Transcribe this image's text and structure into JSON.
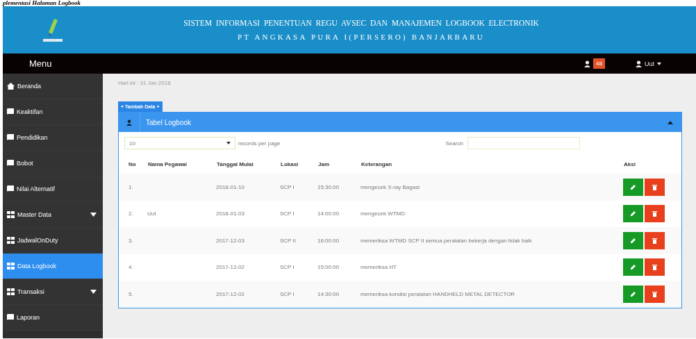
{
  "document_caption": "plementasi Halaman Logbook",
  "header": {
    "title": "SISTEM  INFORMASI  PENENTUAN  REGU  AVSEC  DAN  MANAJEMEN  LOGBOOK  ELECTRONIK",
    "subtitle": "PT ANGKASA PURA I(PERSERO) BANJARBARU"
  },
  "navbar": {
    "menu_label": "Menu",
    "notification_count": "48",
    "user_name": "Uut"
  },
  "sidebar": {
    "items": [
      {
        "label": "Beranda",
        "kind": "home",
        "expandable": false,
        "selected": false
      },
      {
        "label": "Keaktifan",
        "kind": "page",
        "expandable": false,
        "selected": false
      },
      {
        "label": "Pendidikan",
        "kind": "page",
        "expandable": false,
        "selected": false
      },
      {
        "label": "Bobot",
        "kind": "page",
        "expandable": false,
        "selected": false
      },
      {
        "label": "Nilai Alternatif",
        "kind": "page",
        "expandable": false,
        "selected": false
      },
      {
        "label": "Master Data",
        "kind": "grid",
        "expandable": true,
        "selected": false
      },
      {
        "label": "JadwalOnDuty",
        "kind": "grid",
        "expandable": false,
        "selected": false
      },
      {
        "label": "Data Logbook",
        "kind": "grid",
        "expandable": false,
        "selected": true
      },
      {
        "label": "Transaksi",
        "kind": "grid",
        "expandable": true,
        "selected": false
      },
      {
        "label": "Laporan",
        "kind": "page",
        "expandable": false,
        "selected": false
      }
    ]
  },
  "date_text": "Hari ini : 31 Jan 2018",
  "add_button": "+ Tambah Data +",
  "panel": {
    "title": "Tabel Logbook",
    "page_size": "10",
    "page_size_label": "records per page",
    "search_label": "Search",
    "table": {
      "columns": [
        "No",
        "Nama Pegawai",
        "Tanggal Mulai",
        "Lokasi",
        "Jam",
        "Keterangan",
        "Aksi"
      ],
      "rows": [
        [
          "1.",
          "",
          "2018-01-10",
          "SCP I",
          "15:30:00",
          "mengecek X-ray Bagasi"
        ],
        [
          "2.",
          "Uut",
          "2018-01-03",
          "SCP I",
          "14:00:00",
          "mengecek WTMD"
        ],
        [
          "3.",
          "",
          "2017-12-03",
          "SCP II",
          "16:00:00",
          "memeriksa WTMD SCP II semua peralatan bekerja dengan tidak baik"
        ],
        [
          "4.",
          "",
          "2017-12-02",
          "SCP I",
          "15:00:00",
          "memeriksa HT"
        ],
        [
          "5.",
          "",
          "2017-12-02",
          "SCP I",
          "14:30:00",
          "memeriksa kondisi peralatan HANDHELD METAL DETECTOR"
        ]
      ]
    }
  }
}
